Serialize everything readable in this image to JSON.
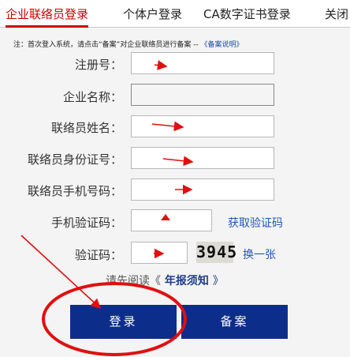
{
  "tabs": {
    "enterprise": "企业联络员登录",
    "individual": "个体户登录",
    "ca": "CA数字证书登录",
    "close": "关闭"
  },
  "notice": {
    "text": "注：首次登入系统，请点击“备案”对企业联络员进行备案 -- ",
    "link": "《备案说明》"
  },
  "form": {
    "reg_no_label": "注册号：",
    "company_label": "企业名称：",
    "contact_name_label": "联络员姓名：",
    "id_no_label": "联络员身份证号：",
    "phone_label": "联络员手机号码：",
    "sms_code_label": "手机验证码：",
    "get_sms_code": "获取验证码",
    "captcha_label": "验证码：",
    "captcha_text": "3945",
    "refresh_captcha": "换一张"
  },
  "read_note": {
    "prefix": "请先阅读《",
    "doc": " 年报须知 ",
    "suffix": "》"
  },
  "buttons": {
    "login": "登录",
    "record": "备案"
  },
  "colors": {
    "accent": "#d00000",
    "button": "#0d2d8a",
    "link": "#2456b8",
    "annotation": "#e01010"
  }
}
